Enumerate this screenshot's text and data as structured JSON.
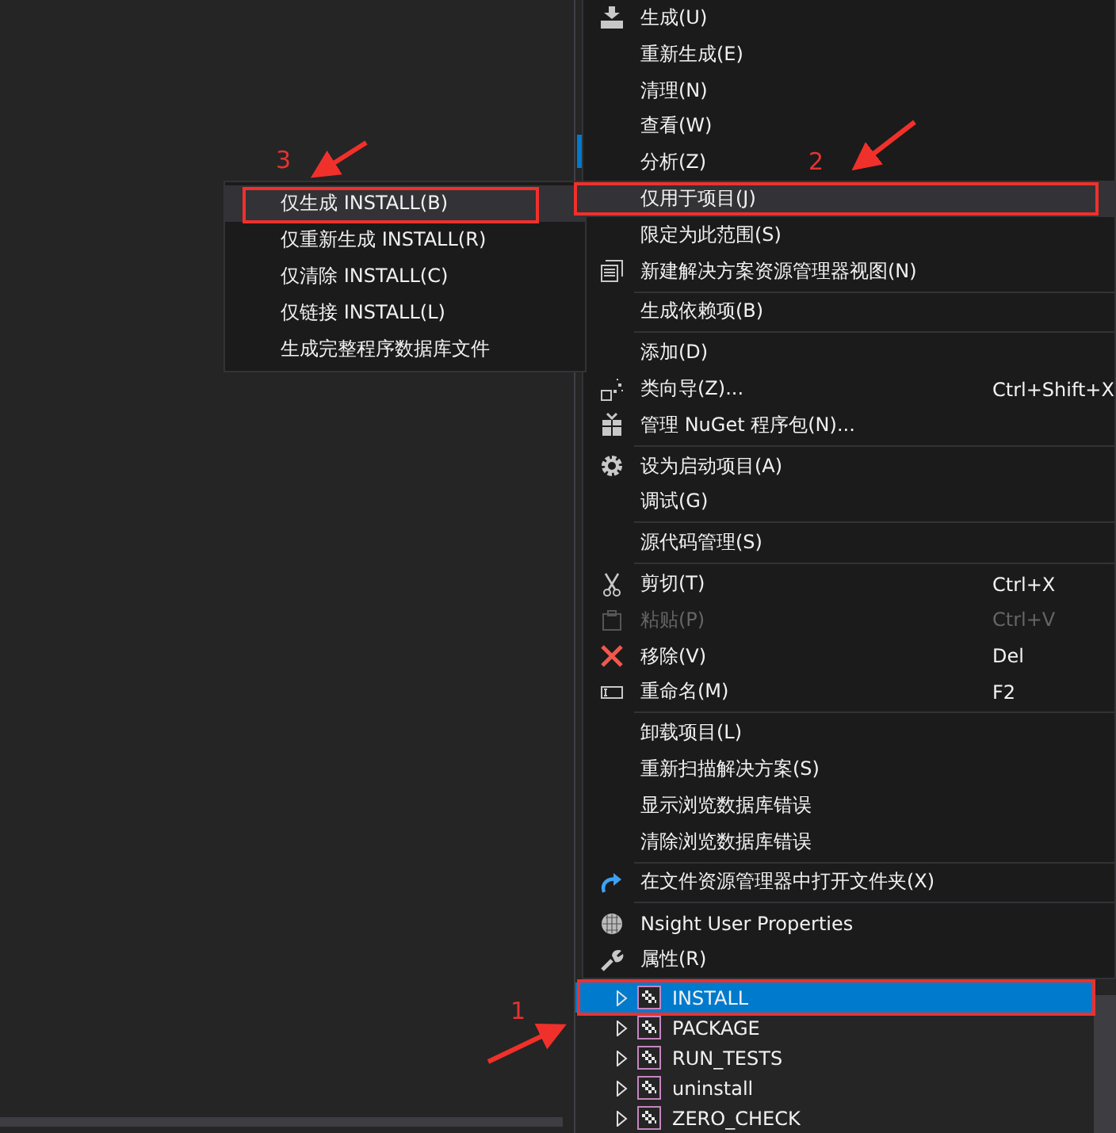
{
  "context_menu": {
    "groups": [
      [
        {
          "label": "生成(U)",
          "disabled": false,
          "highlighted": false
        },
        {
          "label": "重新生成(E)",
          "disabled": false,
          "highlighted": false
        },
        {
          "label": "清理(N)",
          "disabled": false,
          "highlighted": false
        },
        {
          "label": "查看(W)",
          "disabled": false,
          "highlighted": false
        },
        {
          "label": "分析(Z)",
          "disabled": false,
          "highlighted": false
        },
        {
          "label": "仅用于项目(J)",
          "disabled": false,
          "highlighted": true
        },
        {
          "label": "限定为此范围(S)",
          "disabled": false,
          "highlighted": false
        },
        {
          "label": "新建解决方案资源管理器视图(N)",
          "disabled": false,
          "highlighted": false
        }
      ],
      [
        {
          "label": "生成依赖项(B)",
          "disabled": false,
          "highlighted": false
        }
      ],
      [
        {
          "label": "添加(D)",
          "disabled": false,
          "highlighted": false
        },
        {
          "label": "类向导(Z)...",
          "shortcut": "Ctrl+Shift+X",
          "disabled": false,
          "highlighted": false
        },
        {
          "label": "管理 NuGet 程序包(N)...",
          "disabled": false,
          "highlighted": false
        }
      ],
      [
        {
          "label": "设为启动项目(A)",
          "disabled": false,
          "highlighted": false
        },
        {
          "label": "调试(G)",
          "disabled": false,
          "highlighted": false
        }
      ],
      [
        {
          "label": "源代码管理(S)",
          "disabled": false,
          "highlighted": false
        }
      ],
      [
        {
          "label": "剪切(T)",
          "shortcut": "Ctrl+X",
          "disabled": false,
          "highlighted": false
        },
        {
          "label": "粘贴(P)",
          "shortcut": "Ctrl+V",
          "disabled": true,
          "highlighted": false
        },
        {
          "label": "移除(V)",
          "shortcut": "Del",
          "disabled": false,
          "highlighted": false
        },
        {
          "label": "重命名(M)",
          "shortcut": "F2",
          "disabled": false,
          "highlighted": false
        }
      ],
      [
        {
          "label": "卸载项目(L)",
          "disabled": false,
          "highlighted": false
        },
        {
          "label": "重新扫描解决方案(S)",
          "disabled": false,
          "highlighted": false
        },
        {
          "label": "显示浏览数据库错误",
          "disabled": false,
          "highlighted": false
        },
        {
          "label": "清除浏览数据库错误",
          "disabled": false,
          "highlighted": false
        }
      ],
      [
        {
          "label": "在文件资源管理器中打开文件夹(X)",
          "disabled": false,
          "highlighted": false
        }
      ],
      [
        {
          "label": "Nsight User Properties",
          "disabled": false,
          "highlighted": false
        },
        {
          "label": "属性(R)",
          "disabled": false,
          "highlighted": false
        }
      ]
    ]
  },
  "submenu": {
    "items": [
      {
        "label": "仅生成 INSTALL(B)",
        "highlighted": true
      },
      {
        "label": "仅重新生成 INSTALL(R)",
        "highlighted": false
      },
      {
        "label": "仅清除 INSTALL(C)",
        "highlighted": false
      },
      {
        "label": "仅链接 INSTALL(L)",
        "highlighted": false
      },
      {
        "label": "生成完整程序数据库文件",
        "highlighted": false
      }
    ]
  },
  "solution_tree": {
    "items": [
      {
        "label": "INSTALL",
        "selected": true
      },
      {
        "label": "PACKAGE",
        "selected": false
      },
      {
        "label": "RUN_TESTS",
        "selected": false
      },
      {
        "label": "uninstall",
        "selected": false
      },
      {
        "label": "ZERO_CHECK",
        "selected": false
      }
    ]
  },
  "annotations": [
    {
      "label": "1"
    },
    {
      "label": "2"
    },
    {
      "label": "3"
    }
  ]
}
